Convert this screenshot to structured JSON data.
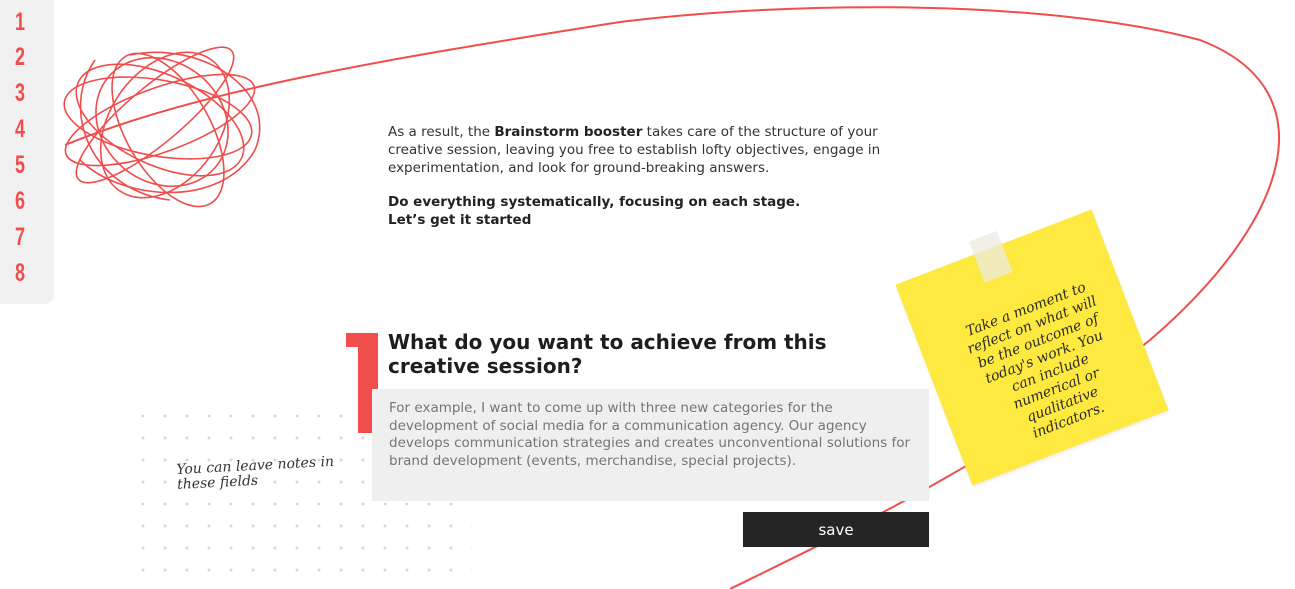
{
  "steps": [
    "1",
    "2",
    "3",
    "4",
    "5",
    "6",
    "7",
    "8"
  ],
  "intro": {
    "line_prefix": "As a result, the ",
    "brand": "Brainstorm booster",
    "line_rest": " takes care of the structure of your creative session, leaving you free to establish lofty objectives, engage in experimentation, and look for ground-breaking answers.",
    "emphasis_line1": "Do everything systematically, focusing on each stage.",
    "emphasis_line2": "Let’s get it started"
  },
  "question": {
    "number": "1",
    "title": "What do you want to achieve from this creative session?",
    "placeholder": "For example, I want to come up with three new categories for the development of social media for a communication agency. Our agency develops communication strategies and creates unconventional solutions for brand development (events, merchandise, special projects)."
  },
  "save_label": "save",
  "handwritten_note": "You can leave notes in these fields",
  "sticky_note": "Take a moment to reflect on what will be the outcome of today's work. You can include numerical or qualitative indicators.",
  "colors": {
    "accent": "#f04d4d",
    "sticky": "#fde93f",
    "dark": "#252525",
    "panel": "#efefef"
  },
  "icons": [
    "scribble-doodle",
    "curved-line-decoration"
  ]
}
